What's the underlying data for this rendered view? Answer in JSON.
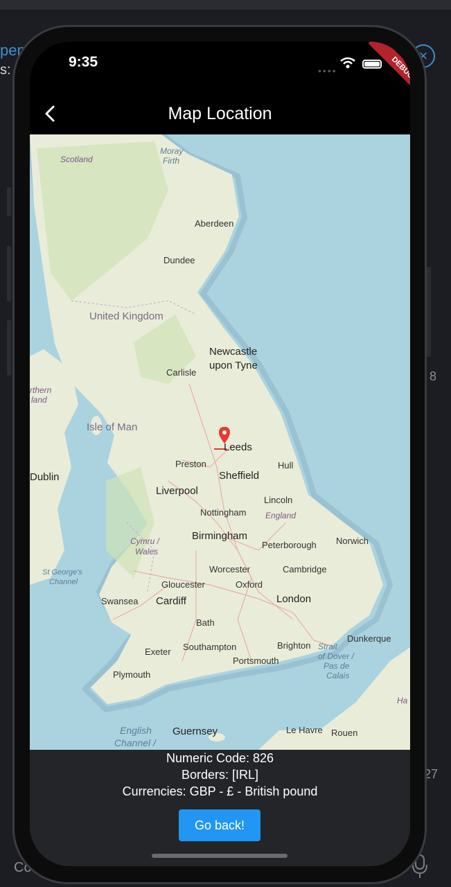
{
  "background": {
    "left_fragment_1": "pen",
    "left_fragment_2": "s:",
    "right_number_1": "8",
    "right_number_2": "27",
    "bottom_left": "Co"
  },
  "status_bar": {
    "time": "9:35",
    "debug_label": "DEBUG"
  },
  "app_bar": {
    "title": "Map Location"
  },
  "map": {
    "labels": {
      "scotland": "Scotland",
      "moray_firth_1": "Moray",
      "moray_firth_2": "Firth",
      "aberdeen": "Aberdeen",
      "dundee": "Dundee",
      "united_kingdom": "United Kingdom",
      "newcastle_1": "Newcastle",
      "newcastle_2": "upon Tyne",
      "carlisle": "Carlisle",
      "isle_of_man": "Isle of Man",
      "northern_ireland_1": "rthern",
      "northern_ireland_2": "land",
      "leeds": "Leeds",
      "preston": "Preston",
      "hull": "Hull",
      "sheffield": "Sheffield",
      "dublin": "Dublin",
      "liverpool": "Liverpool",
      "lincoln": "Lincoln",
      "nottingham": "Nottingham",
      "england": "England",
      "birmingham": "Birmingham",
      "norwich": "Norwich",
      "cymru_1": "Cymru /",
      "cymru_2": "Wales",
      "peterborough": "Peterborough",
      "st_georges_1": "St George's",
      "st_georges_2": "Channel",
      "worcester": "Worcester",
      "cambridge": "Cambridge",
      "gloucester": "Gloucester",
      "oxford": "Oxford",
      "swansea": "Swansea",
      "cardiff": "Cardiff",
      "london": "London",
      "bath": "Bath",
      "dunkerque": "Dunkerque",
      "exeter": "Exeter",
      "southampton": "Southampton",
      "brighton": "Brighton",
      "strait_1": "Strait",
      "strait_2": "of Dover /",
      "strait_3": "Pas de",
      "strait_4": "Calais",
      "portsmouth": "Portsmouth",
      "plymouth": "Plymouth",
      "english_channel_1": "English",
      "english_channel_2": "Channel /",
      "guernsey": "Guernsey",
      "le_havre": "Le Havre",
      "rouen": "Rouen",
      "ha": "Ha"
    },
    "marker_icon": "map-pin-icon"
  },
  "info": {
    "numeric_code": "Numeric Code: 826",
    "borders": "Borders: [IRL]",
    "currencies": "Currencies: GBP - £ - British pound",
    "button_label": "Go back!"
  },
  "colors": {
    "sea": "#aad3df",
    "land": "#f2efe9",
    "accent_button": "#2196f3",
    "marker": "#e53935"
  }
}
